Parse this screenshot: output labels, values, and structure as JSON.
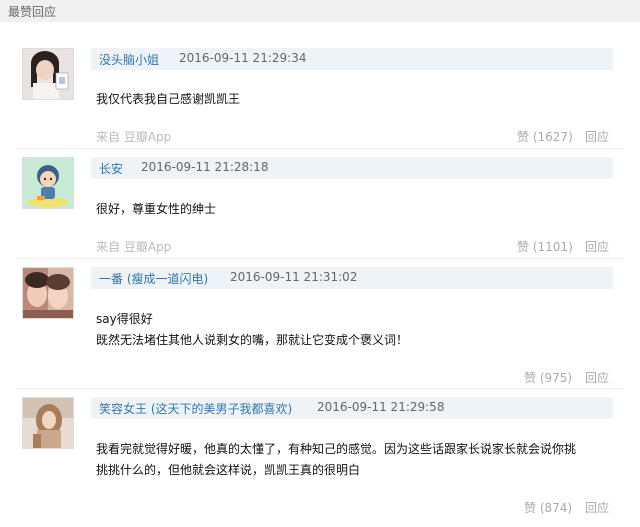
{
  "section": {
    "title": "最赞回应"
  },
  "comments": [
    {
      "username": "没头脑小姐",
      "timestamp": "2016-09-11 21:29:34",
      "lines": [
        "我仅代表我自己感谢凯凯王"
      ],
      "source_prefix": "来自",
      "source_app": "豆瓣App",
      "like_icon": "thumbs-up-icon",
      "like_label": "赞",
      "like_count": "(1627)",
      "reply_label": "回应"
    },
    {
      "username": "长安",
      "timestamp": "2016-09-11 21:28:18",
      "lines": [
        "很好，尊重女性的绅士"
      ],
      "source_prefix": "来自",
      "source_app": "豆瓣App",
      "like_icon": "thumbs-up-icon",
      "like_label": "赞",
      "like_count": "(1101)",
      "reply_label": "回应"
    },
    {
      "username": "一番 (瘦成一道闪电)",
      "timestamp": "2016-09-11 21:31:02",
      "lines": [
        "say得很好",
        "既然无法堵住其他人说剩女的嘴，那就让它变成个褒义词！"
      ],
      "like_icon": "thumbs-up-icon",
      "like_label": "赞",
      "like_count": "(975)",
      "reply_label": "回应"
    },
    {
      "username": "笑容女王 (这天下的美男子我都喜欢)",
      "timestamp": "2016-09-11 21:29:58",
      "lines": [
        "我看完就觉得好暖，他真的太懂了，有种知己的感觉。因为这些话跟家长说家长就会说你挑",
        "挑挑什么的，但他就会这样说，凯凯王真的很明白"
      ],
      "like_icon": "thumbs-up-icon",
      "like_label": "赞",
      "like_count": "(874)",
      "reply_label": "回应"
    }
  ]
}
